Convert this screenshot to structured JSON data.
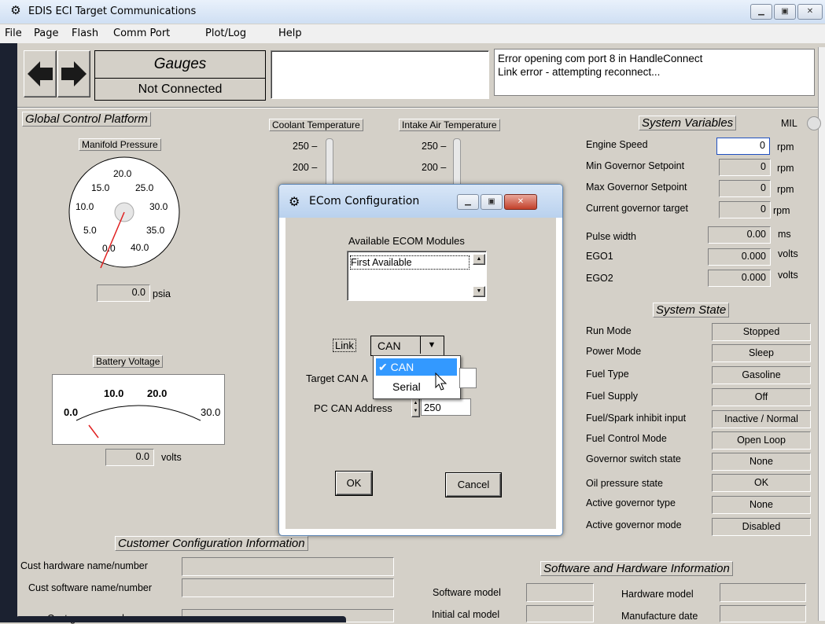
{
  "window": {
    "title": "EDIS ECI Target Communications"
  },
  "menu": [
    "File",
    "Page",
    "Flash",
    "Comm Port",
    "Plot/Log",
    "Help"
  ],
  "header": {
    "page_title": "Gauges",
    "connection_status": "Not Connected",
    "messages": [
      "Error opening com port 8 in HandleConnect",
      "Link error - attempting reconnect..."
    ]
  },
  "gcp": {
    "title": "Global Control Platform",
    "manifold": {
      "label": "Manifold Pressure",
      "ticks": [
        "20.0",
        "15.0",
        "25.0",
        "10.0",
        "30.0",
        "5.0",
        "35.0",
        "0.0",
        "40.0"
      ],
      "value": "0.0",
      "unit": "psia"
    },
    "battery": {
      "label": "Battery Voltage",
      "ticks": [
        "10.0",
        "20.0",
        "0.0",
        "30.0"
      ],
      "value": "0.0",
      "unit": "volts"
    }
  },
  "temps": {
    "coolant": {
      "label": "Coolant Temperature",
      "ticks": [
        "250 –",
        "200 –"
      ]
    },
    "intake": {
      "label": "Intake Air Temperature",
      "ticks": [
        "250 –",
        "200 –"
      ]
    }
  },
  "system_variables": {
    "title": "System Variables",
    "mil_label": "MIL",
    "rows": [
      {
        "label": "Engine Speed",
        "value": "0",
        "unit": "rpm"
      },
      {
        "label": "Min Governor Setpoint",
        "value": "0",
        "unit": "rpm"
      },
      {
        "label": "Max Governor Setpoint",
        "value": "0",
        "unit": "rpm"
      },
      {
        "label": "Current governor target",
        "value": "0",
        "unit": "rpm"
      },
      {
        "label": "Pulse width",
        "value": "0.00",
        "unit": "ms"
      },
      {
        "label": "EGO1",
        "value": "0.000",
        "unit": "volts"
      },
      {
        "label": "EGO2",
        "value": "0.000",
        "unit": "volts"
      }
    ]
  },
  "system_state": {
    "title": "System State",
    "rows": [
      {
        "label": "Run Mode",
        "value": "Stopped"
      },
      {
        "label": "Power Mode",
        "value": "Sleep"
      },
      {
        "label": "Fuel Type",
        "value": "Gasoline"
      },
      {
        "label": "Fuel Supply",
        "value": "Off"
      },
      {
        "label": "Fuel/Spark inhibit input",
        "value": "Inactive / Normal"
      },
      {
        "label": "Fuel Control Mode",
        "value": "Open Loop"
      },
      {
        "label": "Governor switch state",
        "value": "None"
      },
      {
        "label": "Oil pressure state",
        "value": "OK"
      },
      {
        "label": "Active governor type",
        "value": "None"
      },
      {
        "label": "Active governor mode",
        "value": "Disabled"
      }
    ]
  },
  "customer_config": {
    "title": "Customer Configuration Information",
    "rows": [
      "Cust hardware name/number",
      "Cust software name/number",
      "Cust governor cal name"
    ]
  },
  "software_hardware": {
    "title": "Software and Hardware Information",
    "left_labels": [
      "Software model",
      "Initial cal model"
    ],
    "right_labels": [
      "Hardware model",
      "Manufacture date"
    ]
  },
  "dialog": {
    "title": "ECom Configuration",
    "modules_label": "Available  ECOM Modules",
    "modules": [
      "First Available"
    ],
    "link_label": "Link",
    "link_value": "CAN",
    "link_options": [
      {
        "label": "CAN",
        "checked": true
      },
      {
        "label": "Serial",
        "checked": false
      }
    ],
    "target_can_label": "Target CAN A",
    "pc_can_label": "PC CAN Address",
    "pc_can_value": "250",
    "check_mark": "✔",
    "ok_label": "OK",
    "cancel_label": "Cancel"
  }
}
